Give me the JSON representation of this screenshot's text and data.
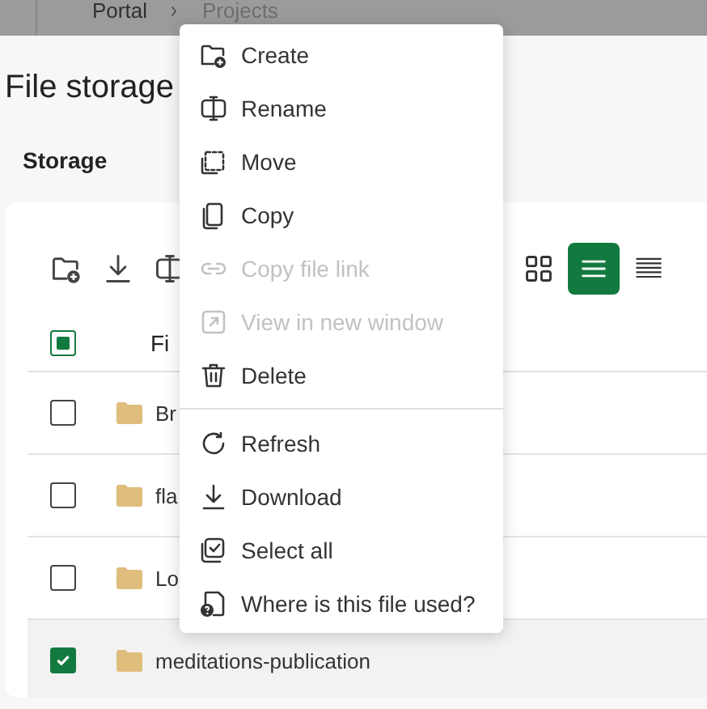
{
  "breadcrumb": [
    "Portal",
    "Projects"
  ],
  "title": "File storage",
  "section": "Storage",
  "view_buttons": [
    {
      "selected": false
    },
    {
      "selected": true
    },
    {
      "selected": false
    }
  ],
  "table": {
    "header_checkbox": {
      "indeterminate": true
    },
    "column_1": "Fi",
    "rows": [
      {
        "name": "Br",
        "checked": false
      },
      {
        "name": "fla",
        "checked": false
      },
      {
        "name": "Lo",
        "checked": false
      },
      {
        "name": "meditations-publication",
        "checked": true
      }
    ]
  },
  "menu": {
    "groups": [
      [
        {
          "label": "Create",
          "disabled": false
        },
        {
          "label": "Rename",
          "disabled": false
        },
        {
          "label": "Move",
          "disabled": false
        },
        {
          "label": "Copy",
          "disabled": false
        },
        {
          "label": "Copy file link",
          "disabled": true
        },
        {
          "label": "View in new window",
          "disabled": true
        },
        {
          "label": "Delete",
          "disabled": false
        }
      ],
      [
        {
          "label": "Refresh",
          "disabled": false
        },
        {
          "label": "Download",
          "disabled": false
        },
        {
          "label": "Select all",
          "disabled": false
        },
        {
          "label": "Where is this file used?",
          "disabled": false
        }
      ]
    ]
  }
}
